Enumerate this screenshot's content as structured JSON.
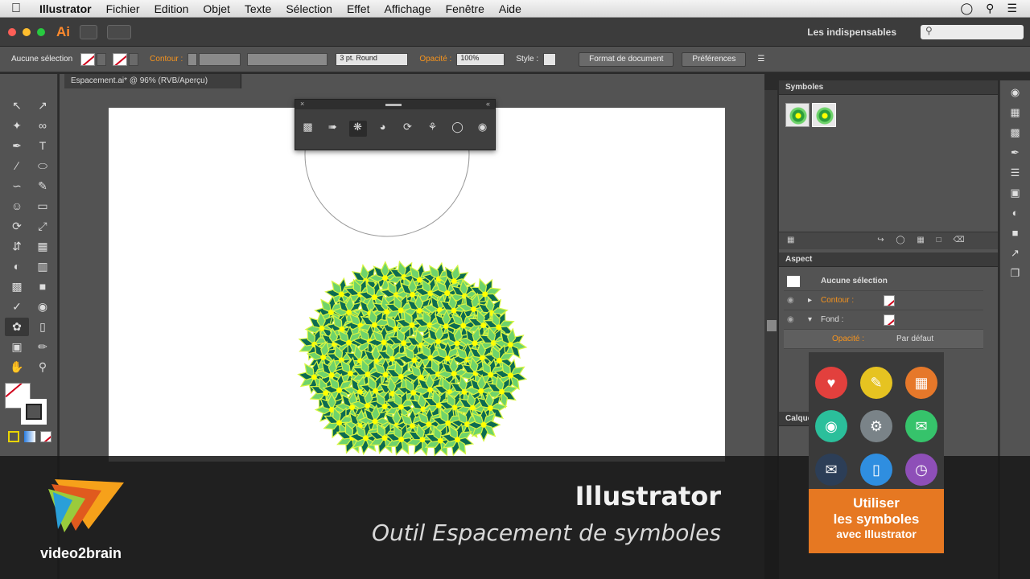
{
  "menubar": {
    "app": "Illustrator",
    "items": [
      "Fichier",
      "Edition",
      "Objet",
      "Texte",
      "Sélection",
      "Effet",
      "Affichage",
      "Fenêtre",
      "Aide"
    ]
  },
  "appbar": {
    "logo": "Ai",
    "workspace": "Les indispensables",
    "search_placeholder": ""
  },
  "control": {
    "selection_label": "Aucune sélection",
    "stroke_label": "Contour :",
    "brush_value": "3 pt. Round",
    "opacity_label": "Opacité :",
    "opacity_value": "100%",
    "style_label": "Style :",
    "doc_format_button": "Format de document",
    "preferences_button": "Préférences"
  },
  "document": {
    "tab_label": "Espacement.ai* @ 96% (RVB/Aperçu)"
  },
  "panels": {
    "symbols_title": "Symboles",
    "aspect_title": "Aspect",
    "layers_title": "Calques",
    "aspect_rows": [
      {
        "label": "Aucune sélection"
      },
      {
        "label": "Contour :"
      },
      {
        "label": "Fond :"
      },
      {
        "label": "Opacité :",
        "value": "Par défaut"
      }
    ]
  },
  "overlay": {
    "title": "Illustrator",
    "subtitle": "Outil Espacement de symboles",
    "brand": "video2brain"
  },
  "promo": {
    "line1": "Utiliser",
    "line2": "les symboles",
    "line3": "avec Illustrator",
    "icons": [
      {
        "name": "heart-icon",
        "color": "#e2403d"
      },
      {
        "name": "pencil-icon",
        "color": "#e6c321"
      },
      {
        "name": "calendar-icon",
        "color": "#e6782a"
      },
      {
        "name": "camera-icon",
        "color": "#2bbf9b"
      },
      {
        "name": "gear-icon",
        "color": "#7a8388"
      },
      {
        "name": "chat-icon",
        "color": "#36c36b"
      },
      {
        "name": "mail-icon",
        "color": "#2c3e57"
      },
      {
        "name": "phone-icon",
        "color": "#2f8ee0"
      },
      {
        "name": "clock-icon",
        "color": "#8e4fb8"
      }
    ]
  },
  "colors": {
    "accent": "#f7941d",
    "flower_dark": "#0c6b52",
    "flower_light": "#6fd36b",
    "flower_center": "#ffff00"
  }
}
